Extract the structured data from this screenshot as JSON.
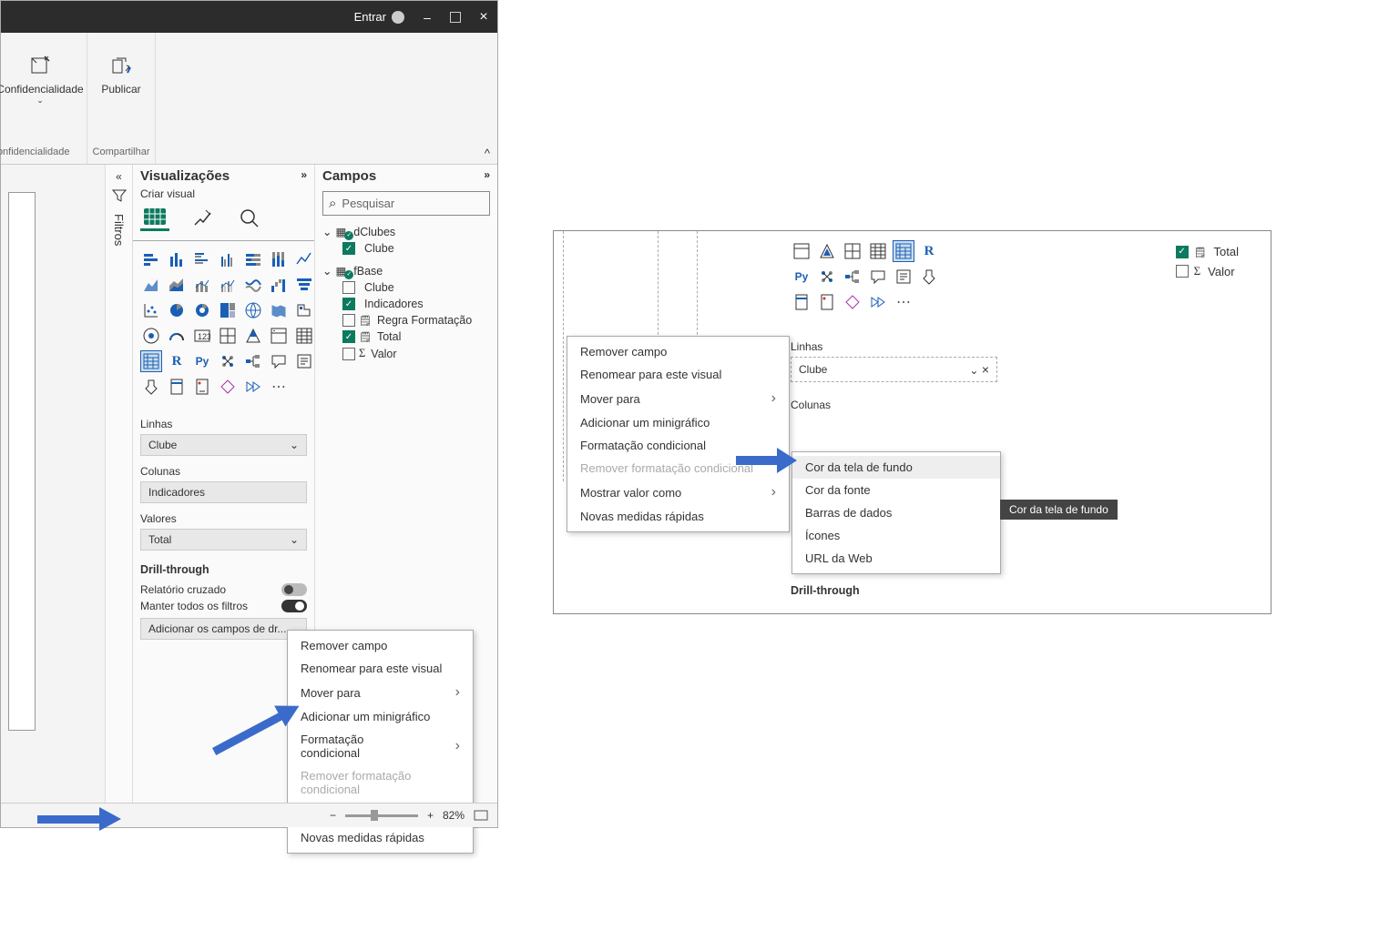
{
  "titlebar": {
    "entrar": "Entrar"
  },
  "ribbon": {
    "conf_label": "Confidencialidade",
    "conf_group": "Confidencialidade",
    "pub_label": "Publicar",
    "pub_group": "Compartilhar"
  },
  "filtros": {
    "label": "Filtros"
  },
  "vis": {
    "title": "Visualizações",
    "subtitle": "Criar visual",
    "r": "R",
    "py": "Py",
    "linhas": "Linhas",
    "clube": "Clube",
    "colunas": "Colunas",
    "indicadores": "Indicadores",
    "valores": "Valores",
    "total": "Total",
    "drill": "Drill-through",
    "rel": "Relatório cruzado",
    "manter": "Manter todos os filtros",
    "addcampos": "Adicionar os campos de dr..."
  },
  "campos": {
    "title": "Campos",
    "placeholder": "Pesquisar",
    "dClubes": "dClubes",
    "clube": "Clube",
    "fBase": "fBase",
    "indicadores": "Indicadores",
    "regra": "Regra Formatação",
    "total": "Total",
    "valor": "Valor"
  },
  "ctx": {
    "remover": "Remover campo",
    "renomear": "Renomear para este visual",
    "mover": "Mover para",
    "minigraf": "Adicionar um minigráfico",
    "formcond": "Formatação condicional",
    "remformcond": "Remover formatação condicional",
    "mostrar": "Mostrar valor como",
    "novas": "Novas medidas rápidas"
  },
  "ctx2": {
    "cor_fundo": "Cor da tela de fundo",
    "cor_fonte": "Cor da fonte",
    "barras": "Barras de dados",
    "icones": "Ícones",
    "url": "URL da Web"
  },
  "right": {
    "linhas": "Linhas",
    "clube": "Clube",
    "colunas": "Colunas",
    "drill": "Drill-through",
    "total": "Total",
    "valor": "Valor"
  },
  "tooltip": "Cor da tela de fundo",
  "status": {
    "zoom": "82%"
  }
}
